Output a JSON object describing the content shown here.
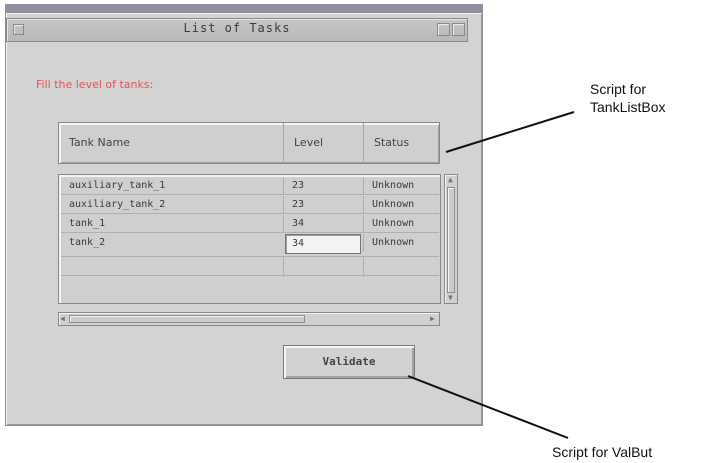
{
  "window": {
    "title": "List of Tasks",
    "prompt": "Fill the level of tanks:"
  },
  "listbox": {
    "columns": [
      "Tank Name",
      "Level",
      "Status"
    ],
    "rows": [
      {
        "name": "auxiliary_tank_1",
        "level": "23",
        "status": "Unknown"
      },
      {
        "name": "auxiliary_tank_2",
        "level": "23",
        "status": "Unknown"
      },
      {
        "name": "tank_1",
        "level": "34",
        "status": "Unknown"
      },
      {
        "name": "tank_2",
        "level": "34",
        "status": "Unknown"
      }
    ]
  },
  "validate_button": {
    "label": "Validate"
  },
  "annotations": {
    "listbox_script": {
      "line1": "Script  for",
      "line2": "TankListBox"
    },
    "button_script": "Script  for  ValBut"
  }
}
